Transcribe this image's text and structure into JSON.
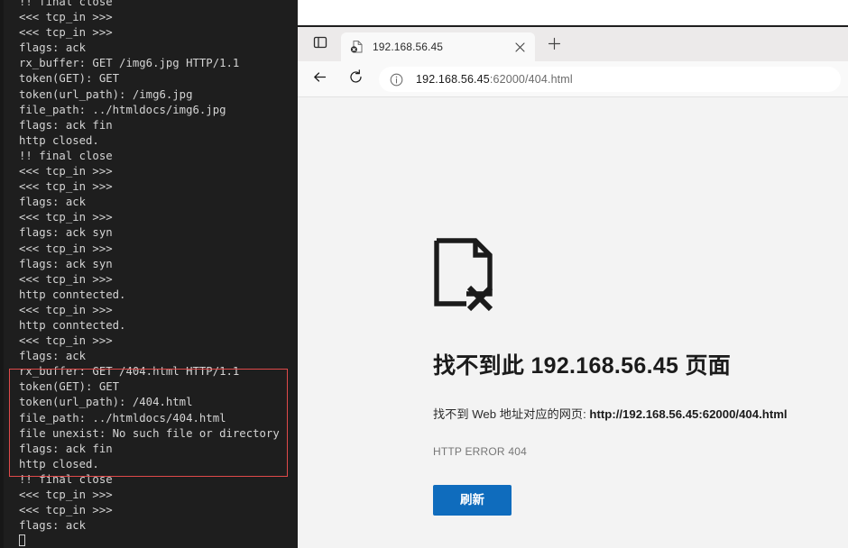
{
  "terminal": {
    "lines": [
      "!! final close",
      "<<< tcp_in >>>",
      "<<< tcp_in >>>",
      "flags: ack",
      "rx_buffer: GET /img6.jpg HTTP/1.1",
      "token(GET): GET",
      "token(url_path): /img6.jpg",
      "file_path: ../htmldocs/img6.jpg",
      "flags: ack fin",
      "http closed.",
      "!! final close",
      "<<< tcp_in >>>",
      "<<< tcp_in >>>",
      "flags: ack",
      "<<< tcp_in >>>",
      "flags: ack syn",
      "<<< tcp_in >>>",
      "flags: ack syn",
      "<<< tcp_in >>>",
      "http conntected.",
      "<<< tcp_in >>>",
      "http conntected.",
      "<<< tcp_in >>>",
      "flags: ack",
      "rx_buffer: GET /404.html HTTP/1.1",
      "token(GET): GET",
      "token(url_path): /404.html",
      "file_path: ../htmldocs/404.html",
      "file unexist: No such file or directory",
      "flags: ack fin",
      "http closed.",
      "!! final close",
      "<<< tcp_in >>>",
      "<<< tcp_in >>>",
      "flags: ack"
    ],
    "highlight_color": "#e04a4a",
    "background": "#1e1e1e",
    "text_color": "#d4d4d4"
  },
  "browser": {
    "collections_icon": "panel-icon",
    "tab": {
      "title": "192.168.56.45",
      "favicon": "broken-document-icon",
      "close_icon": "close-icon"
    },
    "newtab_icon": "plus-icon",
    "toolbar": {
      "back_icon": "back-arrow-icon",
      "refresh_icon": "reload-icon",
      "info_icon": "info-circle-icon",
      "url_host": "192.168.56.45",
      "url_rest": ":62000/404.html"
    },
    "error_page": {
      "icon": "document-error-icon",
      "heading": "找不到此 192.168.56.45 页面",
      "detail_prefix": "找不到 Web 地址对应的网页: ",
      "detail_url": "http://192.168.56.45:62000/404.html",
      "error_code": "HTTP ERROR 404",
      "refresh_button": "刷新",
      "accent_color": "#0f6cbd",
      "background": "#f3f3f3"
    }
  }
}
